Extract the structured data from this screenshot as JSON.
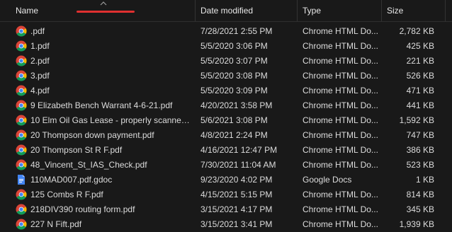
{
  "header": {
    "name_label": "Name",
    "date_label": "Date modified",
    "type_label": "Type",
    "size_label": "Size"
  },
  "colors": {
    "background": "#191919",
    "sort_indicator": "#e03030",
    "text": "#dcdcdc"
  },
  "files": [
    {
      "name": ".pdf",
      "date": "7/28/2021 2:55 PM",
      "type": "Chrome HTML Do...",
      "size": "2,782 KB",
      "icon": "chrome-icon"
    },
    {
      "name": "1.pdf",
      "date": "5/5/2020 3:06 PM",
      "type": "Chrome HTML Do...",
      "size": "425 KB",
      "icon": "chrome-icon"
    },
    {
      "name": "2.pdf",
      "date": "5/5/2020 3:07 PM",
      "type": "Chrome HTML Do...",
      "size": "221 KB",
      "icon": "chrome-icon"
    },
    {
      "name": "3.pdf",
      "date": "5/5/2020 3:08 PM",
      "type": "Chrome HTML Do...",
      "size": "526 KB",
      "icon": "chrome-icon"
    },
    {
      "name": "4.pdf",
      "date": "5/5/2020 3:09 PM",
      "type": "Chrome HTML Do...",
      "size": "471 KB",
      "icon": "chrome-icon"
    },
    {
      "name": "9 Elizabeth Bench Warrant 4-6-21.pdf",
      "date": "4/20/2021 3:58 PM",
      "type": "Chrome HTML Do...",
      "size": "441 KB",
      "icon": "chrome-icon"
    },
    {
      "name": "10 Elm Oil Gas Lease - properly scanned....",
      "date": "5/6/2021 3:08 PM",
      "type": "Chrome HTML Do...",
      "size": "1,592 KB",
      "icon": "chrome-icon"
    },
    {
      "name": "20 Thompson down payment.pdf",
      "date": "4/8/2021 2:24 PM",
      "type": "Chrome HTML Do...",
      "size": "747 KB",
      "icon": "chrome-icon"
    },
    {
      "name": "20 Thompson St R F.pdf",
      "date": "4/16/2021 12:47 PM",
      "type": "Chrome HTML Do...",
      "size": "386 KB",
      "icon": "chrome-icon"
    },
    {
      "name": "48_Vincent_St_IAS_Check.pdf",
      "date": "7/30/2021 11:04 AM",
      "type": "Chrome HTML Do...",
      "size": "523 KB",
      "icon": "chrome-icon"
    },
    {
      "name": "110MAD007.pdf.gdoc",
      "date": "9/23/2020 4:02 PM",
      "type": "Google Docs",
      "size": "1 KB",
      "icon": "google-docs-icon"
    },
    {
      "name": "125 Combs R F.pdf",
      "date": "4/15/2021 5:15 PM",
      "type": "Chrome HTML Do...",
      "size": "814 KB",
      "icon": "chrome-icon"
    },
    {
      "name": "218DIV390 routing form.pdf",
      "date": "3/15/2021 4:17 PM",
      "type": "Chrome HTML Do...",
      "size": "345 KB",
      "icon": "chrome-icon"
    },
    {
      "name": "227 N Fift.pdf",
      "date": "3/15/2021 3:41 PM",
      "type": "Chrome HTML Do...",
      "size": "1,939 KB",
      "icon": "chrome-icon"
    }
  ]
}
